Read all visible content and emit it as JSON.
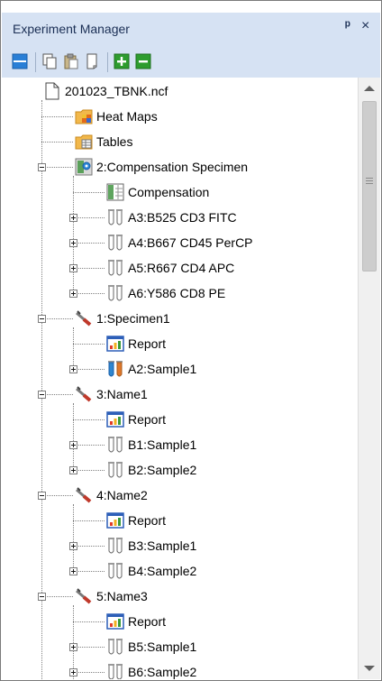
{
  "panel": {
    "title": "Experiment Manager",
    "pin_glyph": "ᵖ",
    "close_glyph": "×"
  },
  "toolbar": [
    {
      "name": "collapse-all-icon"
    },
    {
      "name": "copy-icon"
    },
    {
      "name": "paste-icon"
    },
    {
      "name": "duplicate-icon"
    },
    {
      "name": "add-icon"
    },
    {
      "name": "remove-icon"
    }
  ],
  "tree": [
    {
      "label": "201023_TBNK.ncf",
      "level": 0,
      "icon": "document-icon",
      "expander": "none"
    },
    {
      "label": "Heat Maps",
      "level": 1,
      "icon": "heatmap-folder-icon",
      "expander": "none"
    },
    {
      "label": "Tables",
      "level": 1,
      "icon": "table-folder-icon",
      "expander": "none"
    },
    {
      "label": "2:Compensation Specimen",
      "level": 1,
      "icon": "compensation-specimen-icon",
      "expander": "minus"
    },
    {
      "label": "Compensation",
      "level": 2,
      "icon": "compensation-icon",
      "expander": "none"
    },
    {
      "label": "A3:B525 CD3 FITC",
      "level": 2,
      "icon": "tubes-icon",
      "expander": "plus"
    },
    {
      "label": "A4:B667 CD45 PerCP",
      "level": 2,
      "icon": "tubes-icon",
      "expander": "plus"
    },
    {
      "label": "A5:R667 CD4 APC",
      "level": 2,
      "icon": "tubes-icon",
      "expander": "plus"
    },
    {
      "label": "A6:Y586 CD8 PE",
      "level": 2,
      "icon": "tubes-icon",
      "expander": "plus"
    },
    {
      "label": "1:Specimen1",
      "level": 1,
      "icon": "specimen-syringe-icon",
      "expander": "minus"
    },
    {
      "label": "Report",
      "level": 2,
      "icon": "report-icon",
      "expander": "none"
    },
    {
      "label": "A2:Sample1",
      "level": 2,
      "icon": "colored-tubes-icon",
      "expander": "plus"
    },
    {
      "label": "3:Name1",
      "level": 1,
      "icon": "specimen-syringe-icon",
      "expander": "minus"
    },
    {
      "label": "Report",
      "level": 2,
      "icon": "report-icon",
      "expander": "none"
    },
    {
      "label": "B1:Sample1",
      "level": 2,
      "icon": "tubes-icon",
      "expander": "plus"
    },
    {
      "label": "B2:Sample2",
      "level": 2,
      "icon": "tubes-icon",
      "expander": "plus"
    },
    {
      "label": "4:Name2",
      "level": 1,
      "icon": "specimen-syringe-icon",
      "expander": "minus"
    },
    {
      "label": "Report",
      "level": 2,
      "icon": "report-icon",
      "expander": "none"
    },
    {
      "label": "B3:Sample1",
      "level": 2,
      "icon": "tubes-icon",
      "expander": "plus"
    },
    {
      "label": "B4:Sample2",
      "level": 2,
      "icon": "tubes-icon",
      "expander": "plus"
    },
    {
      "label": "5:Name3",
      "level": 1,
      "icon": "specimen-syringe-icon",
      "expander": "minus"
    },
    {
      "label": "Report",
      "level": 2,
      "icon": "report-icon",
      "expander": "none"
    },
    {
      "label": "B5:Sample1",
      "level": 2,
      "icon": "tubes-icon",
      "expander": "plus"
    },
    {
      "label": "B6:Sample2",
      "level": 2,
      "icon": "tubes-icon",
      "expander": "plus"
    }
  ]
}
